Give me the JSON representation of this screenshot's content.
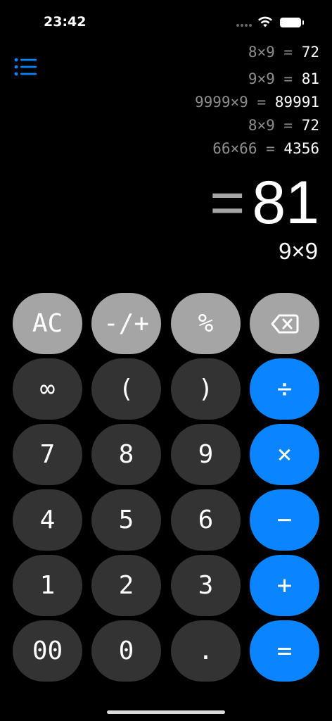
{
  "status_bar": {
    "time": "23:42"
  },
  "history": [
    {
      "expr": "8×9 =",
      "res": "72"
    },
    {
      "expr": "9×9 =",
      "res": "81"
    },
    {
      "expr": "9999×9 =",
      "res": "89991"
    },
    {
      "expr": "8×9 =",
      "res": "72"
    },
    {
      "expr": "66×66 =",
      "res": "4356"
    }
  ],
  "display": {
    "equals_sign": "=",
    "result": "81",
    "expression": "9×9"
  },
  "keys": {
    "ac": "AC",
    "negate": "-/+",
    "percent": "%",
    "infinity": "∞",
    "paren_open": "(",
    "paren_close": ")",
    "divide": "÷",
    "seven": "7",
    "eight": "8",
    "nine": "9",
    "multiply": "×",
    "four": "4",
    "five": "5",
    "six": "6",
    "minus": "−",
    "one": "1",
    "two": "2",
    "three": "3",
    "plus": "+",
    "double_zero": "00",
    "zero": "0",
    "decimal": ".",
    "equals": "="
  },
  "icons": {
    "history": "list-bullet-icon",
    "backspace": "delete-left-icon",
    "wifi": "wifi-icon",
    "battery": "battery-icon"
  },
  "colors": {
    "background": "#000000",
    "key_dark": "#333333",
    "key_light": "#a5a5a5",
    "key_operator": "#0a84ff",
    "history_expression": "#8e8e8e"
  }
}
